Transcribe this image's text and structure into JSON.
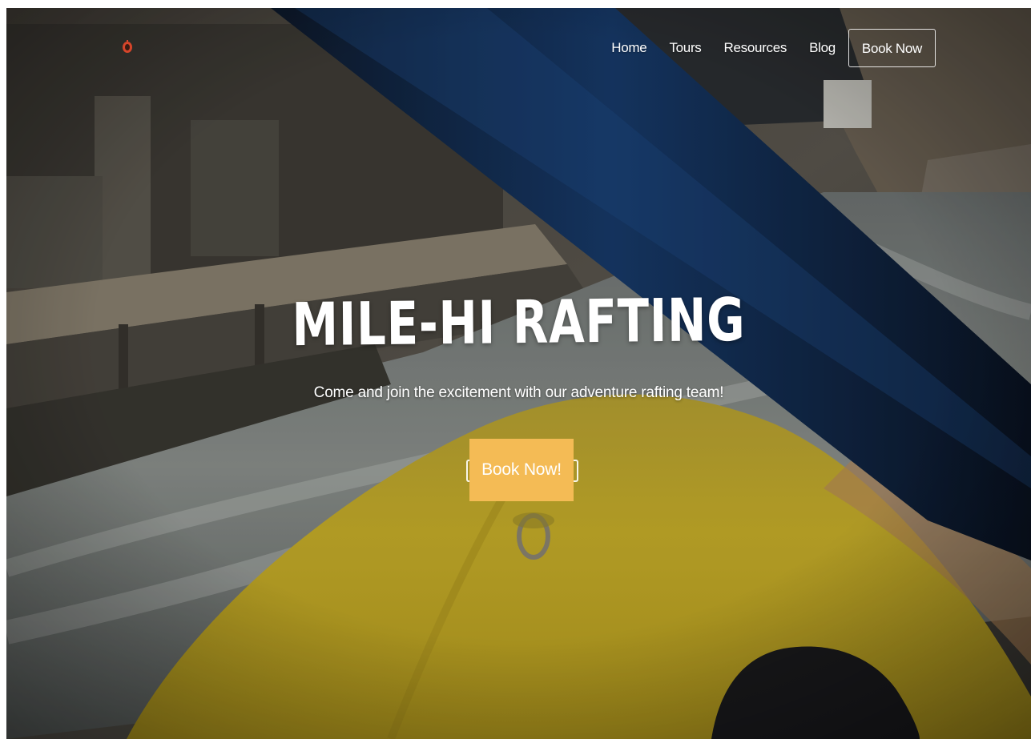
{
  "brand": {
    "logo_icon": "paddle-logo-icon",
    "accent_color": "#d6452a"
  },
  "nav": {
    "items": [
      {
        "label": "Home"
      },
      {
        "label": "Tours"
      },
      {
        "label": "Resources"
      },
      {
        "label": "Blog"
      }
    ],
    "book_label": "Book Now"
  },
  "hero": {
    "title": "MILE-HI RAFTING",
    "subtitle": "Come and join the excitement with our adventure rafting team!",
    "cta_label": "Book Now!",
    "cta_color": "#f4bb55",
    "background": "whitewater-raft-photo"
  }
}
